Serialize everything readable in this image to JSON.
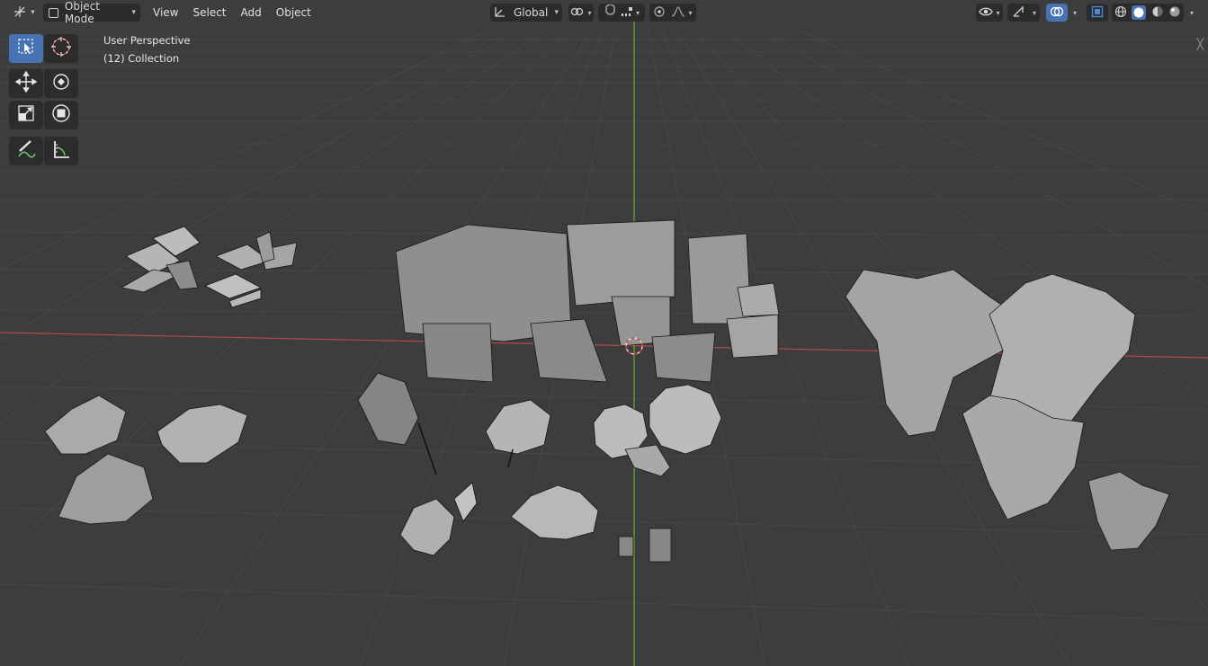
{
  "header": {
    "editor_type_icon": "view3d-icon",
    "mode_label": "Object Mode",
    "menus": [
      "View",
      "Select",
      "Add",
      "Object"
    ],
    "transform_orientation": "Global",
    "pivot_icon": "pivot-icon",
    "snap_icon": "magnet-icon",
    "proportional_icon": "proportional-edit-icon",
    "right_icons": [
      "visibility-icon",
      "gizmo-icon",
      "overlay-icon",
      "xray-icon",
      "wireframe-shading-icon",
      "solid-shading-icon",
      "material-shading-icon",
      "rendered-shading-icon"
    ]
  },
  "viewport": {
    "view_name": "User Perspective",
    "collection_label": "(12) Collection",
    "background_color": "#3d3d3d",
    "grid_color": "#4a4a4a",
    "x_axis_color": "#b34a4a",
    "y_axis_color": "#6a9a3a"
  },
  "toolbar": {
    "tools": [
      {
        "name": "select-box-icon",
        "active": true
      },
      {
        "name": "cursor-icon",
        "active": false
      },
      {
        "name": "move-icon",
        "active": false
      },
      {
        "name": "rotate-icon",
        "active": false
      },
      {
        "name": "scale-icon",
        "active": false
      },
      {
        "name": "transform-icon",
        "active": false
      },
      {
        "name": "annotate-icon",
        "active": false
      },
      {
        "name": "measure-icon",
        "active": false
      }
    ]
  },
  "accent_color": "#4772b3"
}
